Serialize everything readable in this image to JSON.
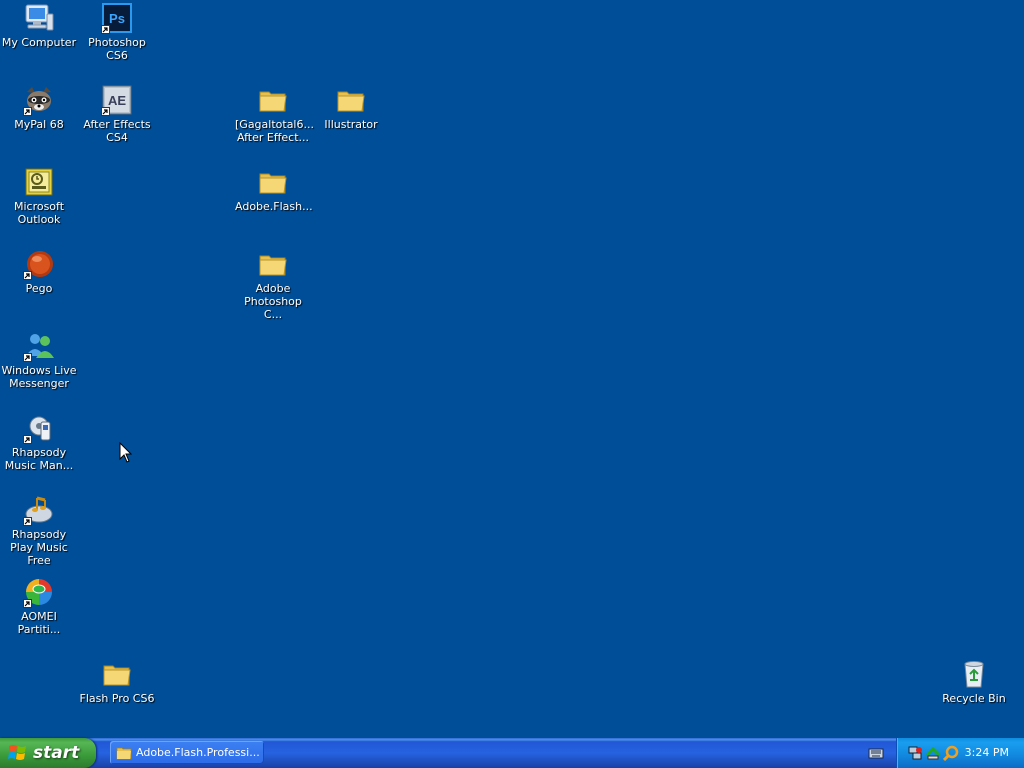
{
  "desktop": {
    "background": "#004e98",
    "icons": {
      "my_computer": "My Computer",
      "photoshop_cs6": "Photoshop CS6",
      "mypal_68": "MyPal 68",
      "after_effects_cs4": "After Effects CS4",
      "gagaltotal_folder": "[Gagaltotal6... After Effect...",
      "illustrator_folder": "Illustrator",
      "microsoft_outlook": "Microsoft Outlook",
      "adobe_flash_folder": "Adobe.Flash...",
      "pego": "Pego",
      "adobe_photoshop_folder": "Adobe Photoshop C...",
      "windows_live_messenger": "Windows Live Messenger",
      "rhapsody_music_manager": "Rhapsody Music Man...",
      "rhapsody_play_music_free": "Rhapsody Play Music Free",
      "aomei_partition": "AOMEI Partiti...",
      "flash_pro_cs6_folder": "Flash Pro CS6",
      "recycle_bin": "Recycle Bin"
    }
  },
  "taskbar": {
    "start_label": "start",
    "task_items": [
      "Adobe.Flash.Professi..."
    ],
    "clock": "3:24 PM",
    "tray_icons": [
      "network-icon",
      "safely-remove-icon",
      "search-icon"
    ]
  }
}
